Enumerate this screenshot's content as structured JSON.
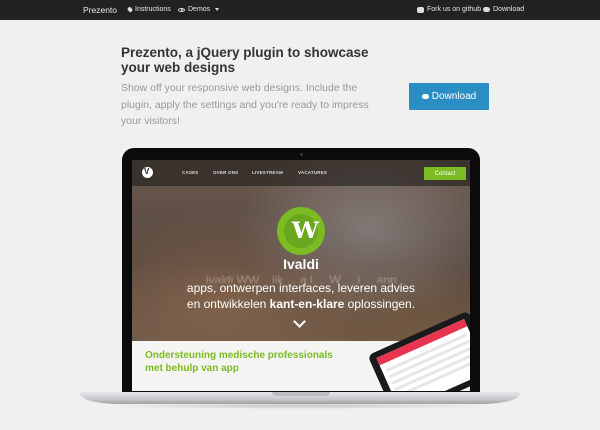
{
  "navbar": {
    "brand": "Prezento",
    "instructions": "Instructions",
    "demos": "Demos",
    "github": "Fork us on github",
    "download": "Download"
  },
  "hero": {
    "title": "Prezento, a jQuery plugin to showcase your web designs",
    "subtitle": "Show off your responsive web designs. Include the plugin, apply the settings and you're ready to impress your visitors!",
    "download_button": "Download"
  },
  "screen": {
    "nav_links": [
      "CASES",
      "OVER ONS",
      "LIVESTREAM",
      "VACATURES"
    ],
    "contact_button": "Contact",
    "company": "Ivaldi",
    "ghost_line": "Ivaldi WW... ijk ... a.l ... W ... j ... app",
    "line1": "apps, ontwerpen interfaces, leveren advies",
    "line2_prefix": "en ontwikkelen ",
    "line2_bold": "kant-en-klare",
    "line2_suffix": " oplossingen.",
    "bottom_text": "Ondersteuning medische professionals met behulp van app"
  },
  "colors": {
    "navbar": "#222222",
    "download_button": "#2a8ec4",
    "accent_green": "#7cbb23",
    "page_bg": "#f0f0f0"
  },
  "icons": {
    "instructions": "pin-icon",
    "demos": "eye-icon",
    "github": "github-icon",
    "download": "cloud-download-icon"
  }
}
